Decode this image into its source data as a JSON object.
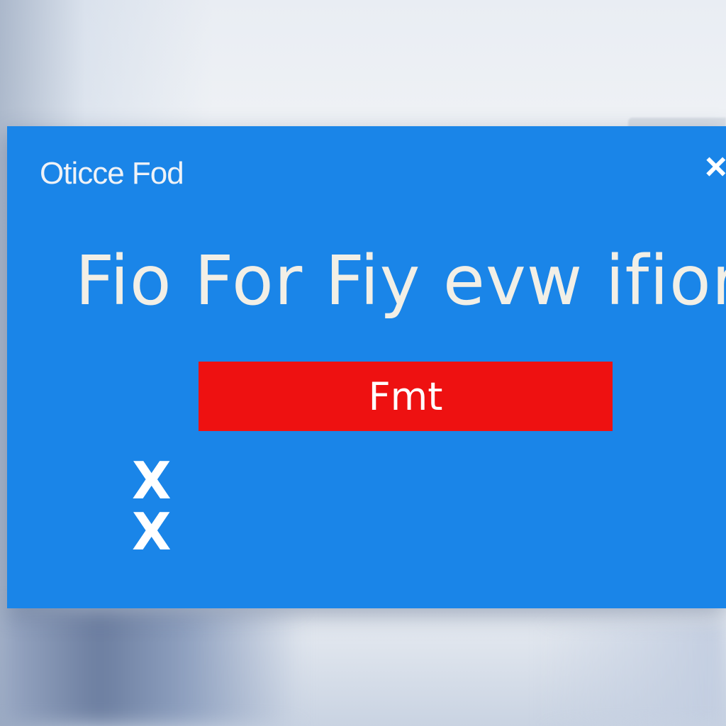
{
  "dialog": {
    "title": "Oticce Fod",
    "close_glyph": "×",
    "headline": "Fio For Fiy evw ifior",
    "primary_button_label": "Fmt",
    "options": [
      {
        "glyph": "X"
      },
      {
        "glyph": "X"
      }
    ]
  },
  "colors": {
    "dialog_background": "#1a85e8",
    "button_background": "#ee1111",
    "text": "#ffffff"
  },
  "icons": {
    "close": "close-icon",
    "option_mark": "x-icon"
  }
}
